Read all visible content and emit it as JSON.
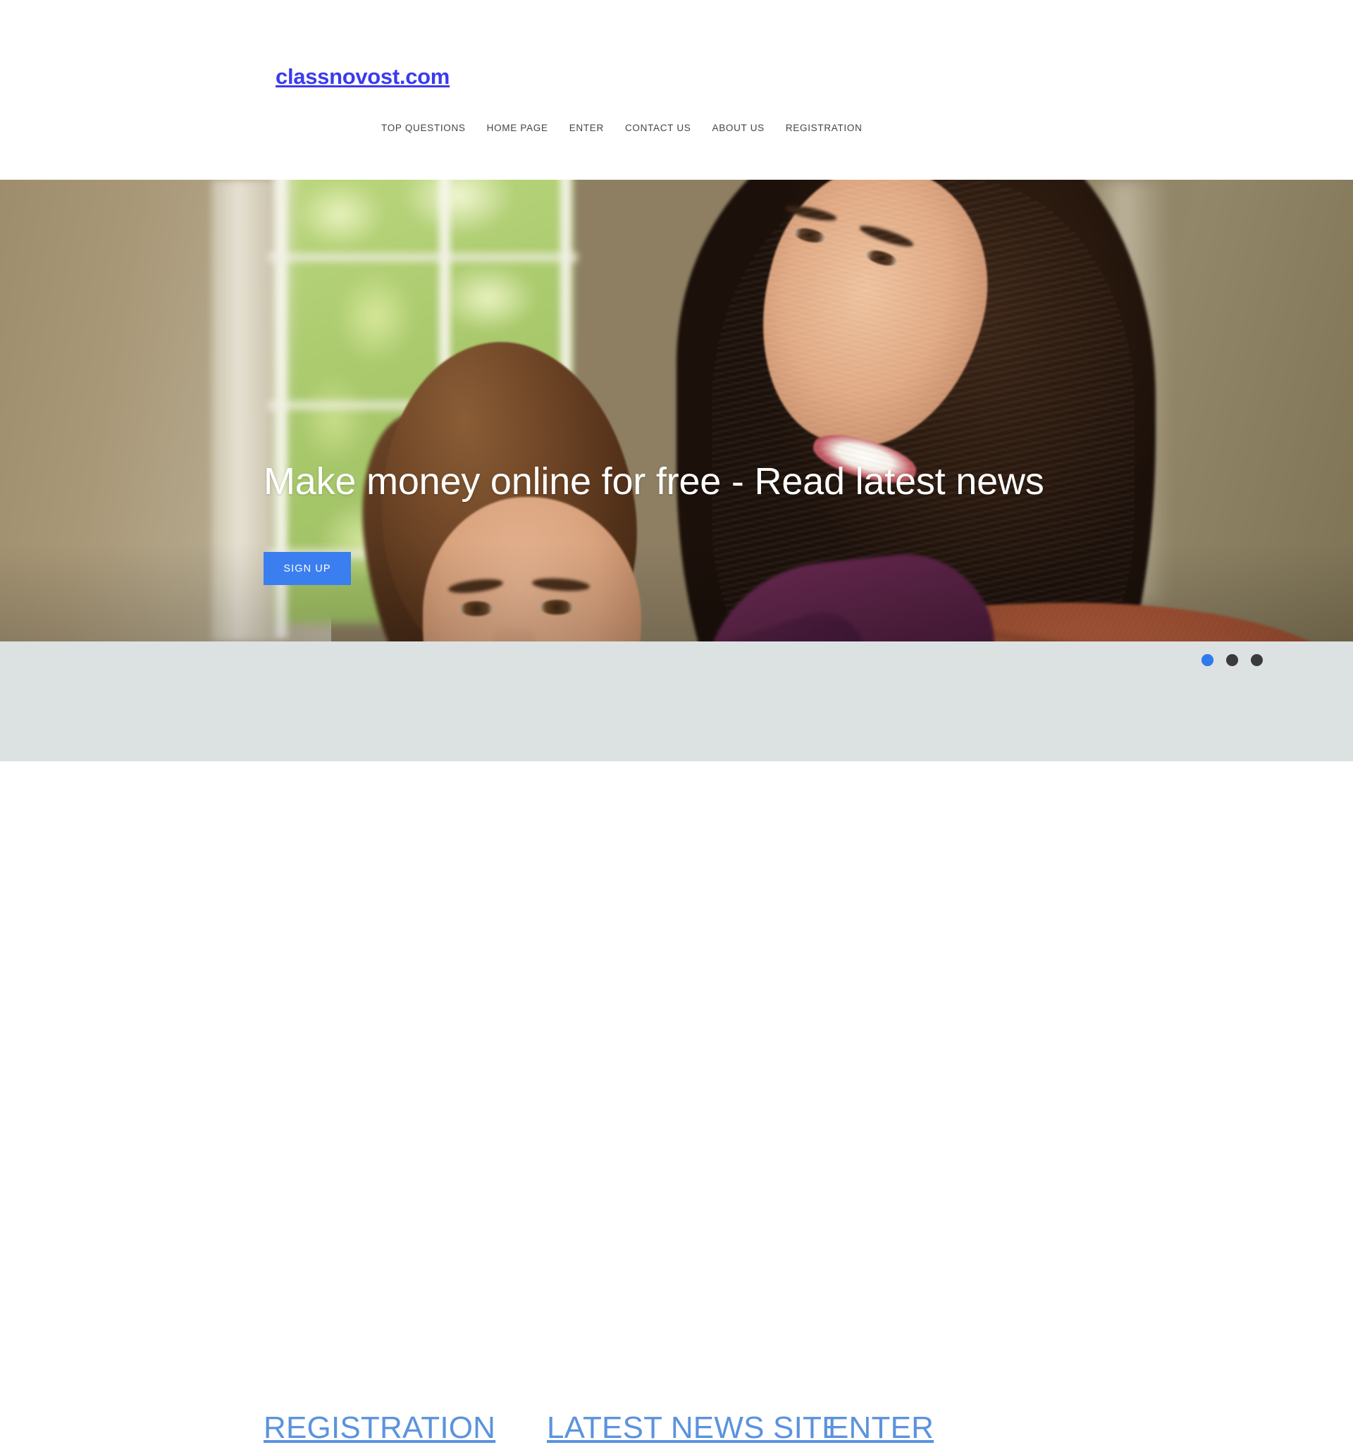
{
  "site": {
    "logo_text": "classnovost.com",
    "logo_color": "#3b3bee"
  },
  "nav": {
    "items": [
      {
        "label": "TOP QUESTIONS"
      },
      {
        "label": "HOME PAGE"
      },
      {
        "label": "ENTER"
      },
      {
        "label": "CONTACT US"
      },
      {
        "label": "ABOUT US"
      },
      {
        "label": "REGISTRATION"
      }
    ]
  },
  "hero": {
    "title": "Make money online for free - Read latest news",
    "cta_label": "SIGN UP",
    "cta_color": "#3b7ef0",
    "image_alt": "smiling couple on a couch at home"
  },
  "carousel": {
    "slides": [
      {
        "index": 1,
        "active": true
      },
      {
        "index": 2,
        "active": false
      },
      {
        "index": 3,
        "active": false
      }
    ],
    "active_color": "#2f7bf0",
    "inactive_color": "#3a3a3a"
  },
  "sections": {
    "background_color": "#dce1e2",
    "link_color": "#5b93dd",
    "items": [
      {
        "label": "REGISTRATION"
      },
      {
        "label": "LATEST NEWS SITE"
      },
      {
        "label": "ENTER"
      }
    ]
  }
}
